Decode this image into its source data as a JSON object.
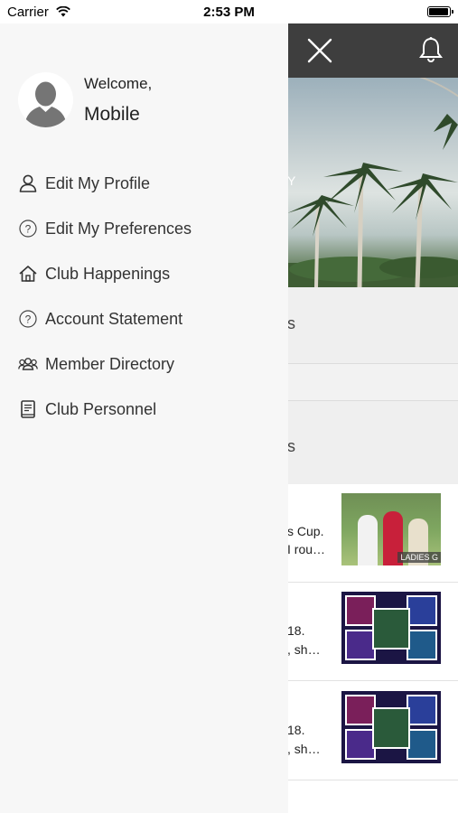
{
  "status_bar": {
    "carrier": "Carrier",
    "time": "2:53 PM",
    "battery_level": 1.0
  },
  "drawer": {
    "welcome": "Welcome,",
    "user_name": "Mobile",
    "menu": [
      {
        "label": "Edit My Profile",
        "icon": "person-icon"
      },
      {
        "label": "Edit My Preferences",
        "icon": "question-circle-icon"
      },
      {
        "label": "Club Happenings",
        "icon": "home-icon"
      },
      {
        "label": "Account Statement",
        "icon": "question-circle-icon"
      },
      {
        "label": "Member Directory",
        "icon": "group-icon"
      },
      {
        "label": "Club Personnel",
        "icon": "book-icon"
      }
    ]
  },
  "background": {
    "hero_text": "Y",
    "section1_text": "s",
    "section2_text": "s",
    "news": [
      {
        "line1": "s Cup.",
        "line2": "I rou…",
        "thumb_badge": "LADIES G"
      },
      {
        "line1": "18.",
        "line2": ", sh…"
      },
      {
        "line1": "18.",
        "line2": ", sh…"
      }
    ]
  }
}
